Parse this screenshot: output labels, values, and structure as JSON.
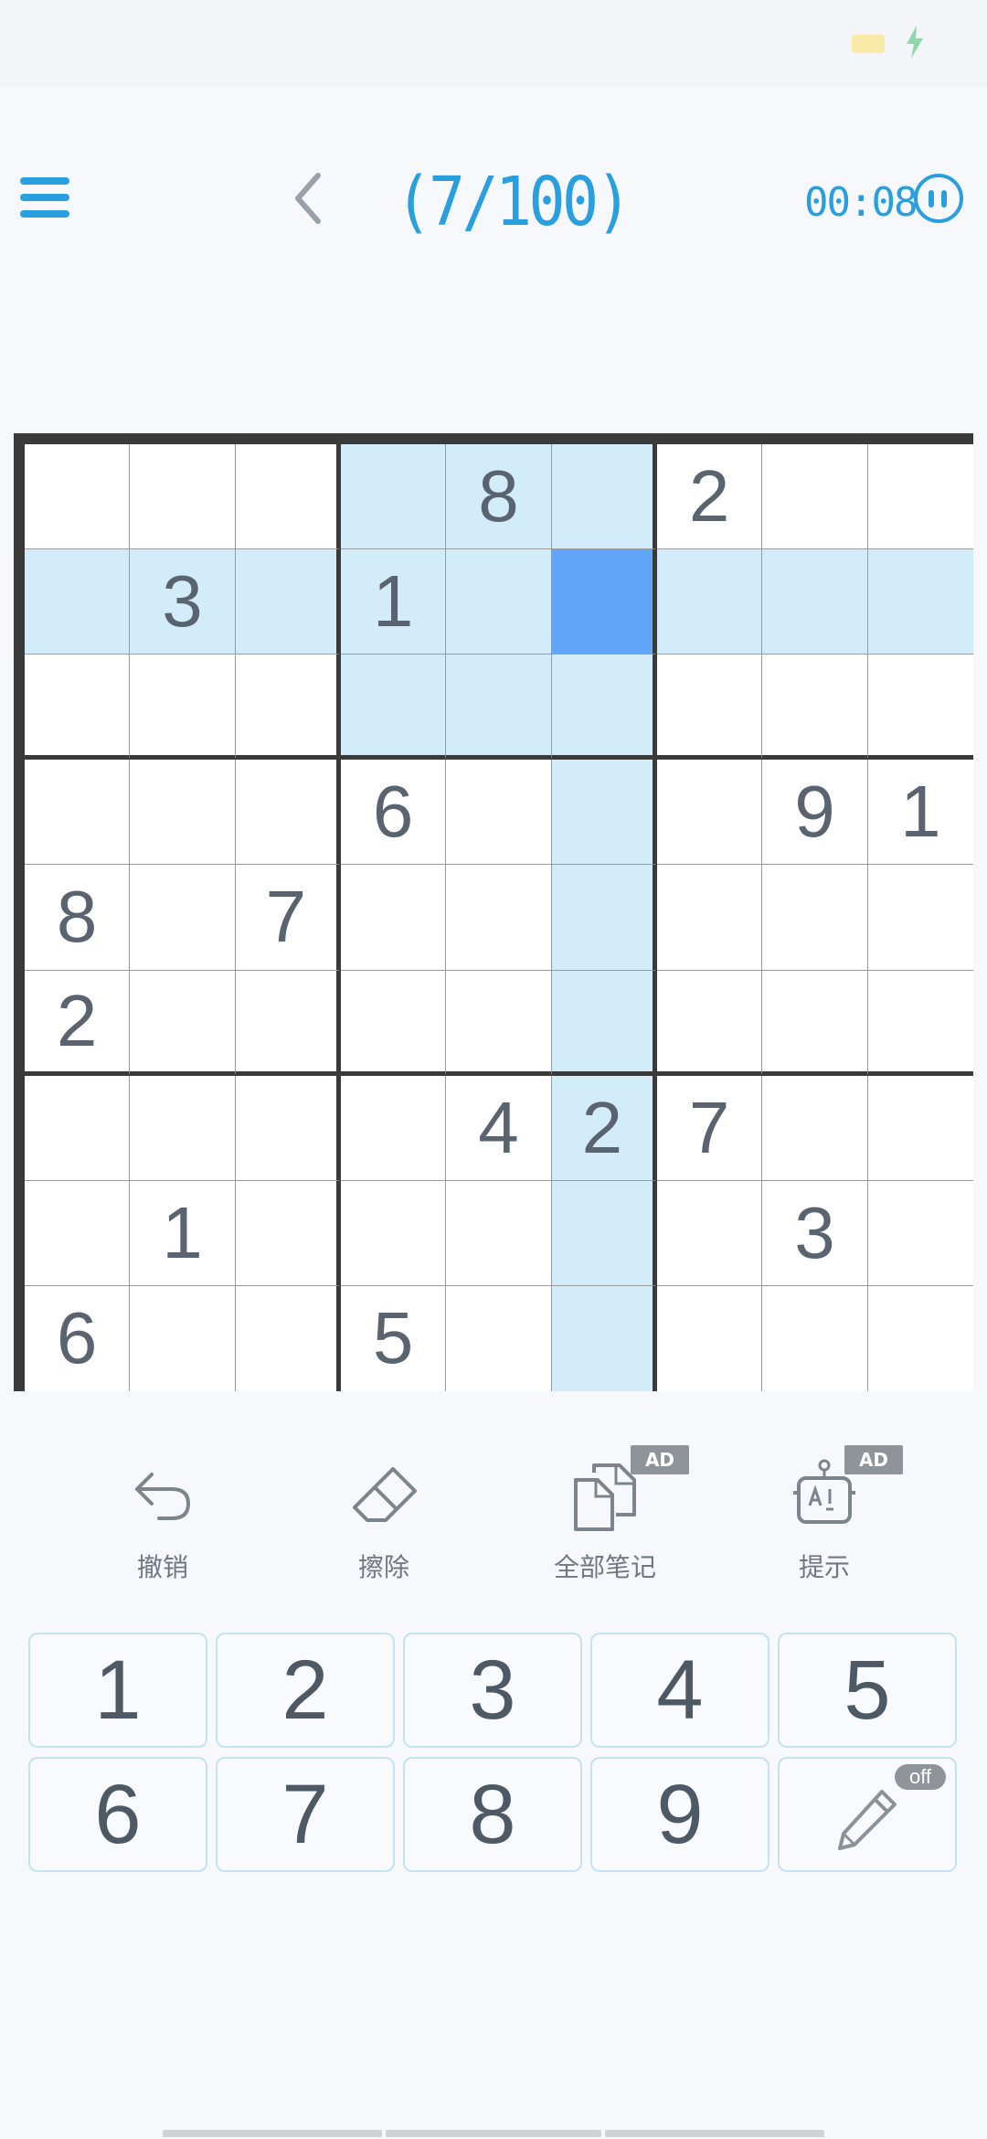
{
  "header": {
    "title": "(7/100)",
    "timer": "00:08"
  },
  "board": {
    "grid": [
      [
        "",
        "",
        "",
        "",
        "8",
        "",
        "2",
        "",
        ""
      ],
      [
        "",
        "3",
        "",
        "1",
        "",
        "",
        "",
        "",
        ""
      ],
      [
        "",
        "",
        "",
        "",
        "",
        "",
        "",
        "",
        ""
      ],
      [
        "",
        "",
        "",
        "6",
        "",
        "",
        "",
        "9",
        "1"
      ],
      [
        "8",
        "",
        "7",
        "",
        "",
        "",
        "",
        "",
        ""
      ],
      [
        "2",
        "",
        "",
        "",
        "",
        "",
        "",
        "",
        ""
      ],
      [
        "",
        "",
        "",
        "",
        "4",
        "2",
        "7",
        "",
        ""
      ],
      [
        "",
        "1",
        "",
        "",
        "",
        "",
        "",
        "3",
        ""
      ],
      [
        "6",
        "",
        "",
        "5",
        "",
        "",
        "",
        "",
        ""
      ]
    ],
    "selected": {
      "row": 2,
      "col": 6
    },
    "highlight_color": "#d3ecfa",
    "selected_color": "#62a6fa"
  },
  "tools": {
    "undo_label": "撤销",
    "erase_label": "擦除",
    "notes_label": "全部笔记",
    "hint_label": "提示",
    "ad_badge": "AD"
  },
  "numpad": {
    "keys": [
      "1",
      "2",
      "3",
      "4",
      "5",
      "6",
      "7",
      "8",
      "9"
    ],
    "pencil_state": "off"
  },
  "colors": {
    "accent": "#2a9fe0",
    "digit": "#5a6470"
  }
}
